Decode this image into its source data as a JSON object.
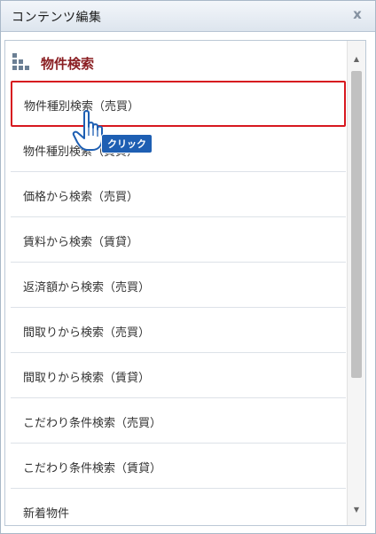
{
  "dialog": {
    "title": "コンテンツ編集",
    "close_label": "x"
  },
  "section": {
    "icon": "grid-icon",
    "title": "物件検索"
  },
  "items": [
    {
      "label": "物件種別検索（売買）",
      "selected": true
    },
    {
      "label": "物件種別検索（賃貸）"
    },
    {
      "label": "価格から検索（売買）"
    },
    {
      "label": "賃料から検索（賃貸）"
    },
    {
      "label": "返済額から検索（売買）"
    },
    {
      "label": "間取りから検索（売買）"
    },
    {
      "label": "間取りから検索（賃貸）"
    },
    {
      "label": "こだわり条件検索（売買）"
    },
    {
      "label": "こだわり条件検索（賃貸）"
    },
    {
      "label": "新着物件"
    }
  ],
  "cursor": {
    "icon": "pointing-hand-icon",
    "badge": "クリック"
  },
  "colors": {
    "section_title": "#8a1e22",
    "selected_border": "#d7181f",
    "badge_bg": "#1e5fb3"
  }
}
